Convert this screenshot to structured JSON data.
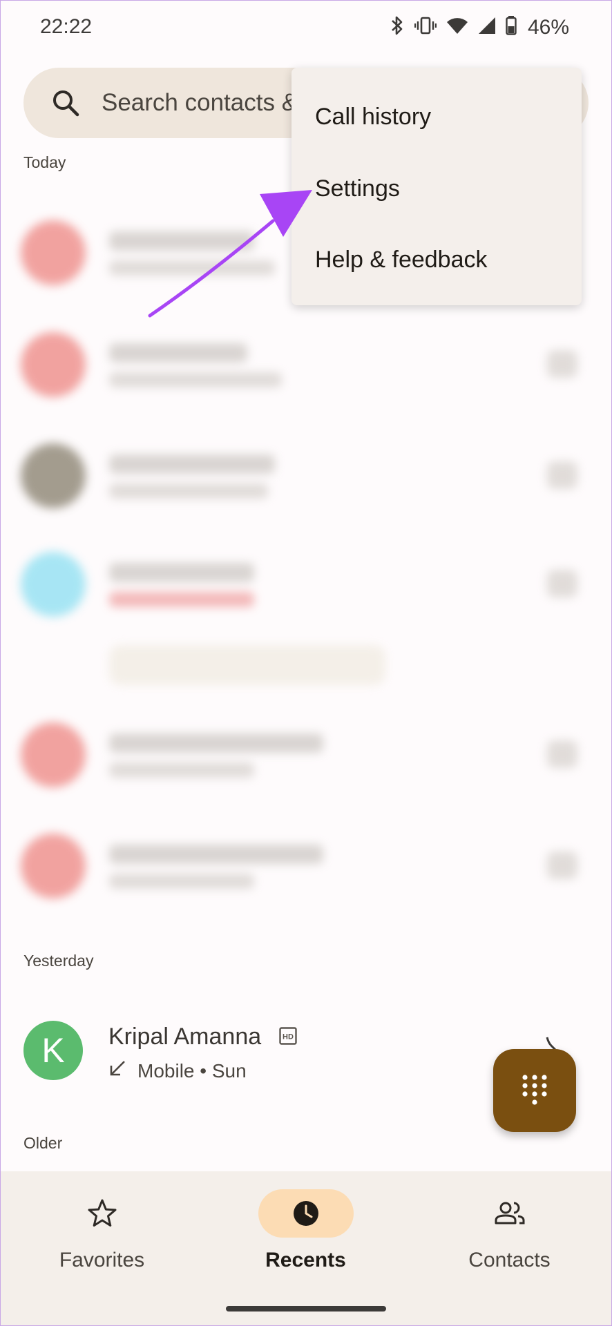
{
  "status_bar": {
    "time": "22:22",
    "battery": "46%"
  },
  "search": {
    "placeholder": "Search contacts &"
  },
  "sections": {
    "today": "Today",
    "yesterday": "Yesterday",
    "older": "Older"
  },
  "contact": {
    "initial": "K",
    "name": "Kripal Amanna",
    "detail": "Mobile • Sun",
    "avatar_color": "#5bbb6e"
  },
  "menu": {
    "items": [
      {
        "label": "Call history"
      },
      {
        "label": "Settings"
      },
      {
        "label": "Help & feedback"
      }
    ]
  },
  "nav": {
    "items": [
      {
        "label": "Favorites",
        "icon": "star-icon",
        "active": false
      },
      {
        "label": "Recents",
        "icon": "clock-icon",
        "active": true
      },
      {
        "label": "Contacts",
        "icon": "people-icon",
        "active": false
      }
    ]
  },
  "colors": {
    "accent_fab": "#7a4f10",
    "active_tab_pill": "#fcdcb4",
    "annotation_arrow": "#a845f5"
  }
}
